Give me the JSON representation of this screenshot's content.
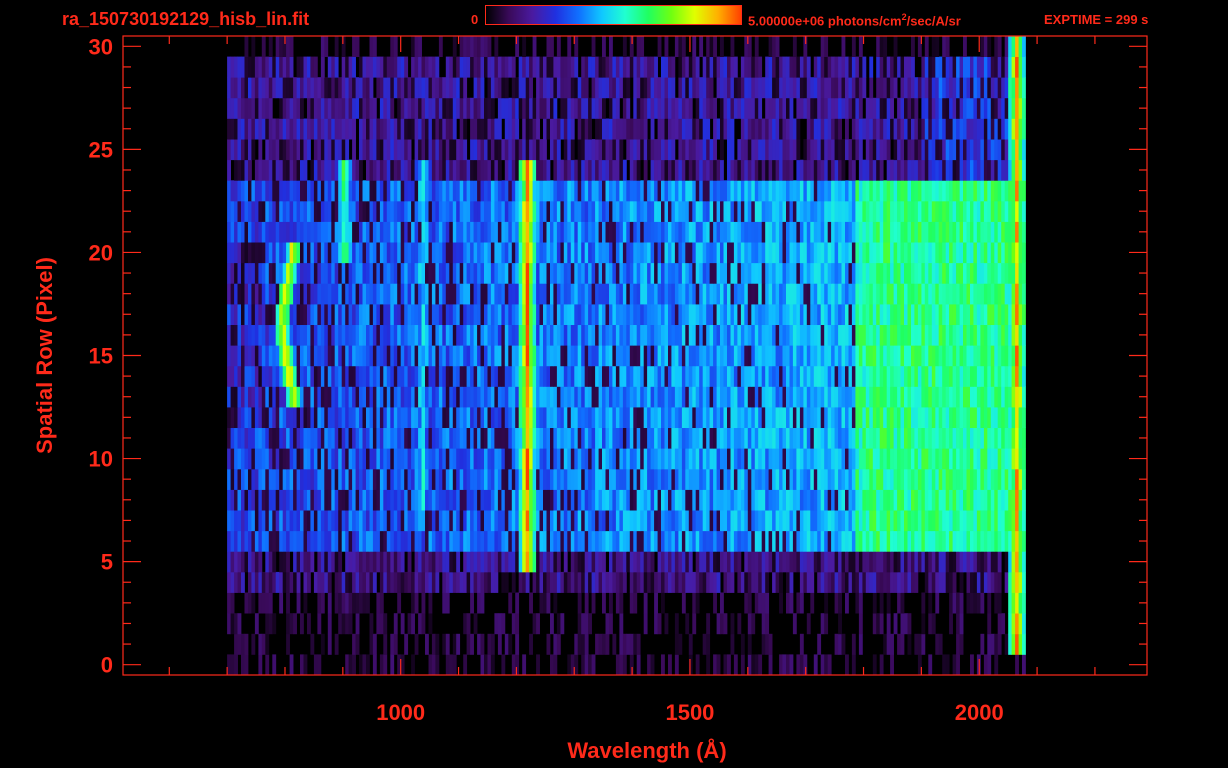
{
  "header": {
    "filename": "ra_150730192129_hisb_lin.fit",
    "colorbar_min": "0",
    "colorbar_max_prefix": "5.00000e+06 photons/cm",
    "colorbar_max_sup": "2",
    "colorbar_max_suffix": "/sec/A/sr",
    "exptime": "EXPTIME = 299 s"
  },
  "colors": {
    "axis": "#ff2a1a",
    "background": "#000000",
    "colormap": [
      "#000000",
      "#3a0a5a",
      "#4a1aa0",
      "#2030e0",
      "#1070ff",
      "#10c8ff",
      "#20ffd0",
      "#20ff60",
      "#70ff10",
      "#e0ff00",
      "#ffb000",
      "#ff4000"
    ]
  },
  "chart_data": {
    "type": "heatmap",
    "title": "ra_150730192129_hisb_lin.fit",
    "xlabel": "Wavelength (Å)",
    "ylabel": "Spatial Row (Pixel)",
    "xlim": [
      520,
      2290
    ],
    "ylim": [
      -0.5,
      30.5
    ],
    "xticks": [
      1000,
      1500,
      2000
    ],
    "yticks": [
      0,
      5,
      10,
      15,
      20,
      25,
      30
    ],
    "x_minor_step": 100,
    "y_minor_step": 1,
    "colorbar_range": [
      0,
      5000000
    ],
    "colorbar_units": "photons/cm^2/sec/A/sr",
    "exptime_s": 299,
    "data_extent": {
      "x": [
        700,
        2075
      ],
      "rows": [
        0,
        30
      ]
    },
    "features": [
      {
        "name": "bright emission line",
        "x": 1216,
        "rows": [
          5,
          24
        ],
        "level": 0.95
      },
      {
        "name": "arc feature",
        "x": 790,
        "rows": [
          13,
          20
        ],
        "level": 0.85
      },
      {
        "name": "upper arc",
        "x": 900,
        "rows": [
          20,
          24
        ],
        "level": 0.65
      },
      {
        "name": "vertical line",
        "x": 1035,
        "rows": [
          8,
          24
        ],
        "level": 0.5
      },
      {
        "name": "green continuum",
        "x_range": [
          1800,
          2060
        ],
        "rows": [
          6,
          23
        ],
        "level": 0.6
      },
      {
        "name": "edge line",
        "x": 2062,
        "rows": [
          1,
          30
        ],
        "level": 0.9
      }
    ]
  }
}
